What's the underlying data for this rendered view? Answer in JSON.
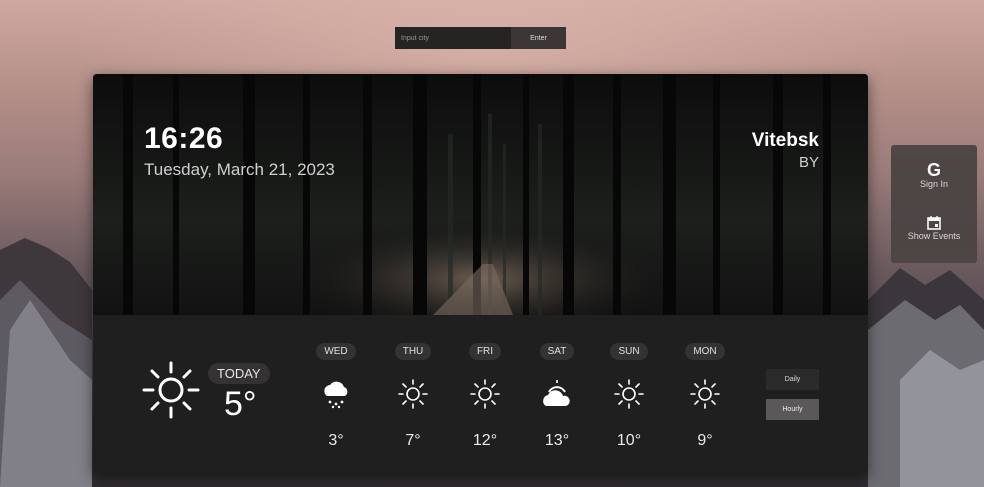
{
  "search": {
    "placeholder": "Input city",
    "button_label": "Enter"
  },
  "clock": {
    "time": "16:26",
    "date": "Tuesday, March 21, 2023"
  },
  "location": {
    "city": "Vitebsk",
    "country": "BY"
  },
  "today": {
    "label": "TODAY",
    "temp": "5°",
    "icon": "sun-icon"
  },
  "forecast": [
    {
      "day": "WED",
      "temp": "3°",
      "icon": "cloud-snow-icon"
    },
    {
      "day": "THU",
      "temp": "7°",
      "icon": "sun-icon"
    },
    {
      "day": "FRI",
      "temp": "12°",
      "icon": "sun-icon"
    },
    {
      "day": "SAT",
      "temp": "13°",
      "icon": "sun-cloud-icon"
    },
    {
      "day": "SUN",
      "temp": "10°",
      "icon": "sun-icon"
    },
    {
      "day": "MON",
      "temp": "9°",
      "icon": "sun-icon"
    }
  ],
  "mode": {
    "daily_label": "Daily",
    "hourly_label": "Hourly",
    "active": "Hourly"
  },
  "side": {
    "sign_in_icon": "G",
    "sign_in_label": "Sign In",
    "events_label": "Show Events"
  }
}
